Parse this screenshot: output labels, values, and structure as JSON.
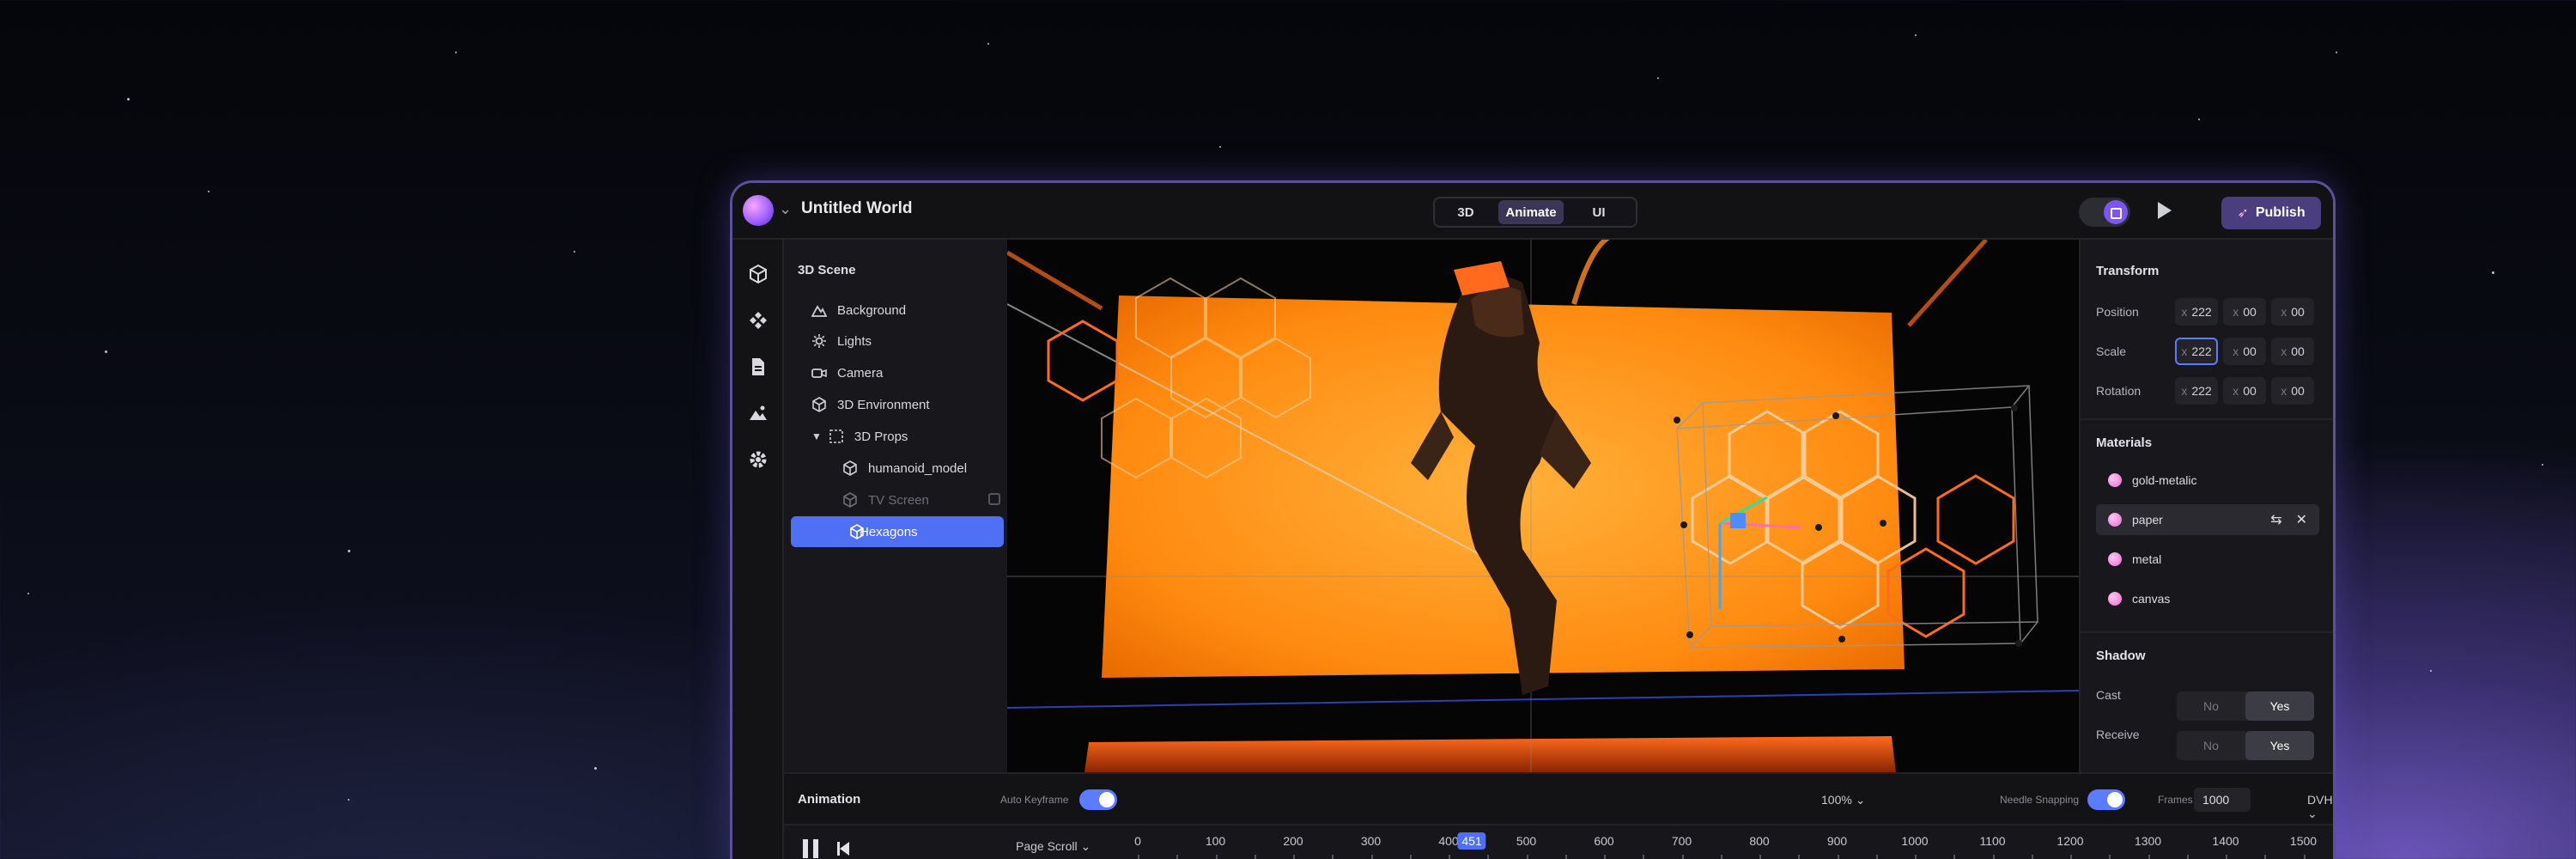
{
  "app": {
    "title": "Untitled World"
  },
  "modes": [
    "3D",
    "Animate",
    "UI"
  ],
  "toolbar": {
    "publish_label": "Publish"
  },
  "scene": {
    "header": "3D Scene",
    "items": [
      {
        "label": "Background",
        "icon": "terrain-icon"
      },
      {
        "label": "Lights",
        "icon": "sun-icon"
      },
      {
        "label": "Camera",
        "icon": "camera-icon"
      },
      {
        "label": "3D Environment",
        "icon": "cube-icon"
      },
      {
        "label": "3D Props",
        "icon": "group-icon"
      },
      {
        "label": "humanoid_model",
        "icon": "cube-icon"
      },
      {
        "label": "TV Screen",
        "icon": "cube-icon"
      },
      {
        "label": "Hexagons",
        "icon": "cube-icon"
      }
    ]
  },
  "transform": {
    "header": "Transform",
    "rows": [
      {
        "label": "Position",
        "x": "222",
        "y": "00",
        "z": "00"
      },
      {
        "label": "Scale",
        "x": "222",
        "y": "00",
        "z": "00"
      },
      {
        "label": "Rotation",
        "x": "222",
        "y": "00",
        "z": "00"
      }
    ],
    "axis": "x"
  },
  "materials": {
    "header": "Materials",
    "items": [
      "gold-metalic",
      "paper",
      "metal",
      "canvas"
    ]
  },
  "shadow": {
    "header": "Shadow",
    "cast_label": "Cast",
    "receive_label": "Receive",
    "no": "No",
    "yes": "Yes"
  },
  "animation": {
    "header": "Animation",
    "auto_keyframe": "Auto Keyframe",
    "zoom": "100%",
    "needle_snapping": "Needle Snapping",
    "frames_label": "Frames",
    "frames_value": "1000",
    "unit": "DVH",
    "page_scroll": "Page Scroll",
    "playhead": "451",
    "ticks": [
      "0",
      "100",
      "200",
      "300",
      "400",
      "500",
      "600",
      "700",
      "800",
      "900",
      "1000",
      "1100",
      "1200",
      "1300",
      "1400",
      "1500"
    ]
  },
  "colors": {
    "accent": "#4f6ff5",
    "publish": "#4a3e7e",
    "screen": "#ff9a1f"
  }
}
